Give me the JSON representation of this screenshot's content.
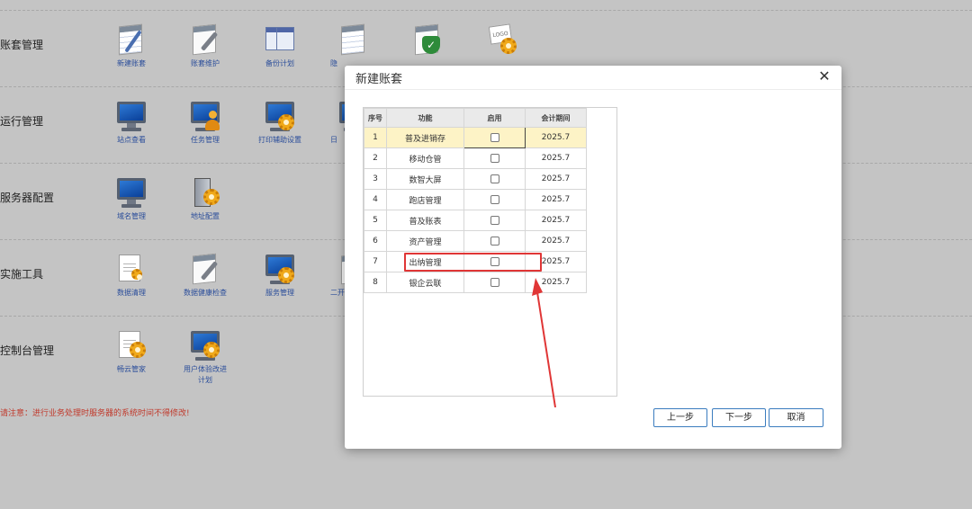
{
  "sections": [
    {
      "title": "账套管理",
      "items": [
        {
          "label": "新建账套",
          "icon": "new-ledger-icon"
        },
        {
          "label": "账套维护",
          "icon": "ledger-maintain-icon"
        },
        {
          "label": "备份计划",
          "icon": "backup-plan-icon"
        },
        {
          "label": "",
          "icon": "notepad-icon",
          "partial": "隐"
        },
        {
          "label": "",
          "icon": "security-shield-icon"
        },
        {
          "label": "",
          "icon": "logo-settings-icon"
        }
      ]
    },
    {
      "title": "运行管理",
      "items": [
        {
          "label": "站点查看",
          "icon": "monitor-icon"
        },
        {
          "label": "任务管理",
          "icon": "task-user-icon"
        },
        {
          "label": "打印辅助设置",
          "icon": "print-gear-icon"
        },
        {
          "label": "",
          "icon": "monitor-icon",
          "partial": "日"
        }
      ]
    },
    {
      "title": "服务器配置",
      "items": [
        {
          "label": "域名管理",
          "icon": "monitor-icon"
        },
        {
          "label": "地址配置",
          "icon": "server-gear-icon"
        }
      ]
    },
    {
      "title": "实施工具",
      "items": [
        {
          "label": "数据清理",
          "icon": "document-icon"
        },
        {
          "label": "数据健康检查",
          "icon": "health-check-icon"
        },
        {
          "label": "服务管理",
          "icon": "service-gear-icon"
        },
        {
          "label": "",
          "icon": "tool-icon",
          "partial": "二开"
        }
      ]
    },
    {
      "title": "控制台管理",
      "items": [
        {
          "label": "畅云管家",
          "icon": "cloud-manager-icon"
        },
        {
          "label": "用户体验改进\n计划",
          "icon": "experience-gear-icon"
        }
      ]
    }
  ],
  "notice": "请注意：进行业务处理时服务器的系统时间不得修改!",
  "modal": {
    "title": "新建账套",
    "close_glyph": "✕",
    "columns": [
      "序号",
      "功能",
      "启用",
      "会计期间"
    ],
    "rows": [
      {
        "no": "1",
        "func": "普及进销存",
        "enabled": false,
        "period": "2025.7"
      },
      {
        "no": "2",
        "func": "移动仓管",
        "enabled": false,
        "period": "2025.7"
      },
      {
        "no": "3",
        "func": "数智大屏",
        "enabled": false,
        "period": "2025.7"
      },
      {
        "no": "4",
        "func": "跑店管理",
        "enabled": false,
        "period": "2025.7"
      },
      {
        "no": "5",
        "func": "普及账表",
        "enabled": false,
        "period": "2025.7"
      },
      {
        "no": "6",
        "func": "资产管理",
        "enabled": false,
        "period": "2025.7"
      },
      {
        "no": "7",
        "func": "出纳管理",
        "enabled": false,
        "period": "2025.7"
      },
      {
        "no": "8",
        "func": "银企云联",
        "enabled": false,
        "period": "2025.7"
      }
    ],
    "buttons": {
      "prev": "上一步",
      "next": "下一步",
      "cancel": "取消"
    },
    "highlight_color": "#e03636"
  }
}
